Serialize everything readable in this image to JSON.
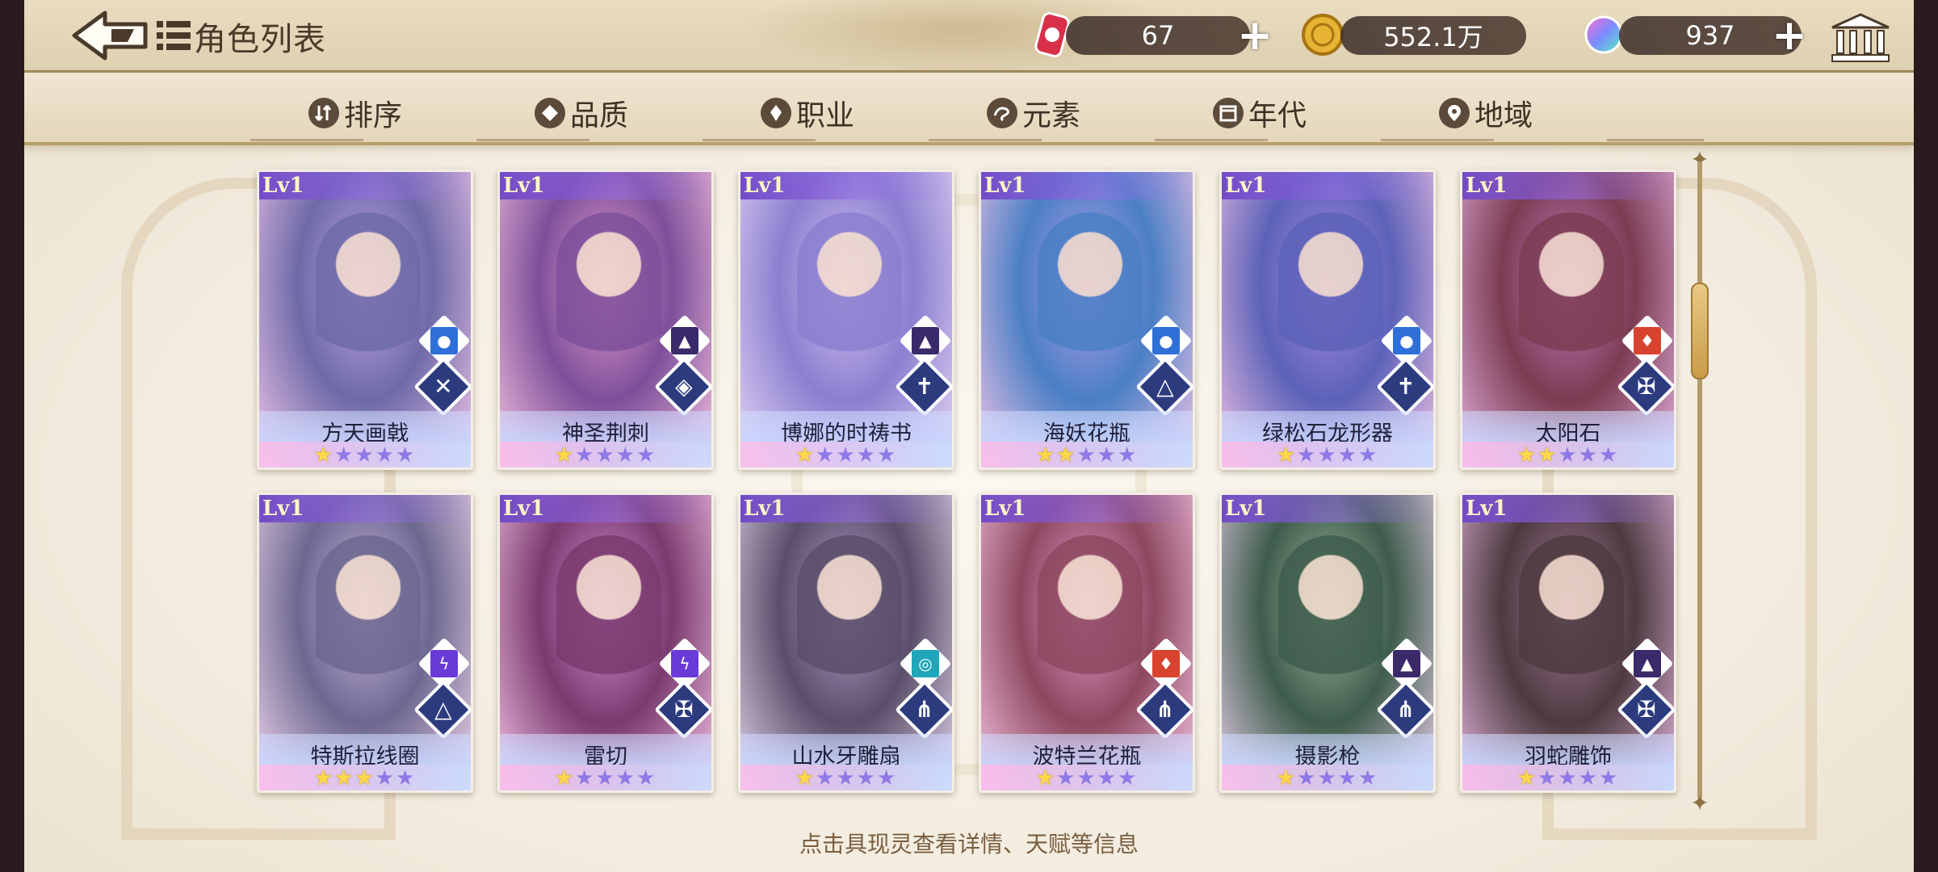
{
  "header": {
    "title": "角色列表",
    "resources": [
      {
        "name": "stamina",
        "icon": "can-icon",
        "value": "67"
      },
      {
        "name": "gold",
        "icon": "coin-icon",
        "value": "552.1万"
      },
      {
        "name": "gem",
        "icon": "gem-icon",
        "value": "937"
      }
    ]
  },
  "tabs": [
    {
      "label": "排序",
      "icon": "sort-icon"
    },
    {
      "label": "品质",
      "icon": "quality-icon"
    },
    {
      "label": "职业",
      "icon": "class-icon"
    },
    {
      "label": "元素",
      "icon": "element-icon"
    },
    {
      "label": "年代",
      "icon": "era-icon"
    },
    {
      "label": "地域",
      "icon": "location-pin-icon"
    }
  ],
  "cards": [
    {
      "level": "Lv1",
      "name": "方天画戟",
      "stars": 1,
      "element": "water",
      "class": "crossed-weapons"
    },
    {
      "level": "Lv1",
      "name": "神圣荆刺",
      "stars": 1,
      "element": "earth",
      "class": "shield"
    },
    {
      "level": "Lv1",
      "name": "博娜的时祷书",
      "stars": 1,
      "element": "earth",
      "class": "cross"
    },
    {
      "level": "Lv1",
      "name": "海妖花瓶",
      "stars": 2,
      "element": "water",
      "class": "book"
    },
    {
      "level": "Lv1",
      "name": "绿松石龙形器",
      "stars": 1,
      "element": "water",
      "class": "cross"
    },
    {
      "level": "Lv1",
      "name": "太阳石",
      "stars": 2,
      "element": "fire",
      "class": "dagger"
    },
    {
      "level": "Lv1",
      "name": "特斯拉线圈",
      "stars": 3,
      "element": "thunder",
      "class": "book"
    },
    {
      "level": "Lv1",
      "name": "雷切",
      "stars": 1,
      "element": "thunder",
      "class": "dagger"
    },
    {
      "level": "Lv1",
      "name": "山水牙雕扇",
      "stars": 1,
      "element": "wind",
      "class": "claw"
    },
    {
      "level": "Lv1",
      "name": "波特兰花瓶",
      "stars": 1,
      "element": "fire",
      "class": "claw"
    },
    {
      "level": "Lv1",
      "name": "摄影枪",
      "stars": 1,
      "element": "earth",
      "class": "claw"
    },
    {
      "level": "Lv1",
      "name": "羽蛇雕饰",
      "stars": 1,
      "element": "earth",
      "class": "dagger"
    }
  ],
  "element_colors": {
    "water": "#2f6fd8",
    "earth": "#3a2a6a",
    "fire": "#d8432f",
    "thunder": "#6a3ad8",
    "wind": "#1fa6b8"
  },
  "hint": "点击具现灵查看详情、天赋等信息"
}
